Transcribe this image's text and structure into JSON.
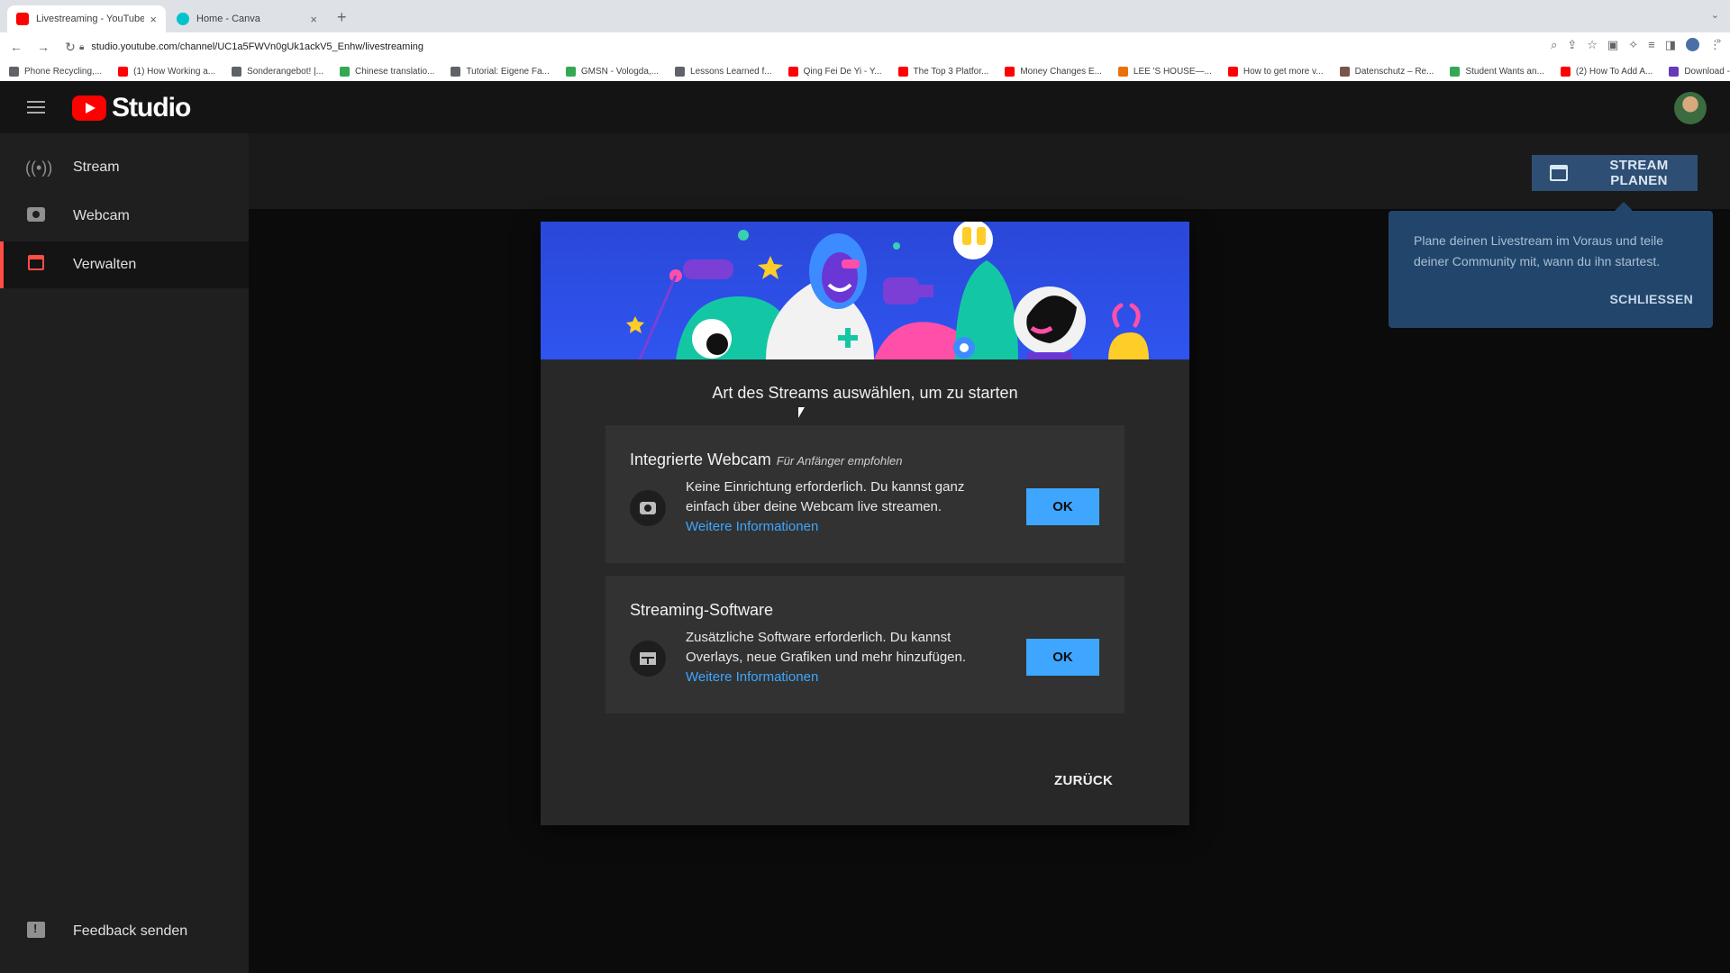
{
  "browser": {
    "tabs": [
      {
        "title": "Livestreaming - YouTube Studio",
        "favicon_color": "#ff0000"
      },
      {
        "title": "Home - Canva",
        "favicon_color": "#00c4cc"
      }
    ],
    "close_glyph": "×",
    "new_tab_glyph": "+",
    "url": "studio.youtube.com/channel/UC1a5FWVn0gUk1ackV5_Enhw/livestreaming",
    "bookmarks": [
      {
        "label": "Phone Recycling,...",
        "color": "#5f6368"
      },
      {
        "label": "(1) How Working a...",
        "color": "#ff0000"
      },
      {
        "label": "Sonderangebot! |...",
        "color": "#5f6368"
      },
      {
        "label": "Chinese translatio...",
        "color": "#34a853"
      },
      {
        "label": "Tutorial: Eigene Fa...",
        "color": "#5f6368"
      },
      {
        "label": "GMSN - Vologda,...",
        "color": "#34a853"
      },
      {
        "label": "Lessons Learned f...",
        "color": "#5f6368"
      },
      {
        "label": "Qing Fei De Yi - Y...",
        "color": "#ff0000"
      },
      {
        "label": "The Top 3 Platfor...",
        "color": "#ff0000"
      },
      {
        "label": "Money Changes E...",
        "color": "#ff0000"
      },
      {
        "label": "LEE 'S HOUSE—...",
        "color": "#e8710a"
      },
      {
        "label": "How to get more v...",
        "color": "#ff0000"
      },
      {
        "label": "Datenschutz – Re...",
        "color": "#795548"
      },
      {
        "label": "Student Wants an...",
        "color": "#34a853"
      },
      {
        "label": "(2) How To Add A...",
        "color": "#ff0000"
      },
      {
        "label": "Download - Cooki...",
        "color": "#673ab7"
      }
    ]
  },
  "app": {
    "logo_text": "Studio",
    "accent": "#ff4e45",
    "sidebar": {
      "items": [
        {
          "label": "Stream",
          "icon": "broadcast-icon"
        },
        {
          "label": "Webcam",
          "icon": "camera-icon"
        },
        {
          "label": "Verwalten",
          "icon": "calendar-icon",
          "active": true
        }
      ],
      "feedback_label": "Feedback senden"
    },
    "plan_button_label": "STREAM PLANEN",
    "tooltip": {
      "text": "Plane deinen Livestream im Voraus und teile deiner Community mit, wann du ihn startest.",
      "close_label": "SCHLIESSEN"
    },
    "dialog": {
      "title": "Art des Streams auswählen, um zu starten",
      "options": [
        {
          "title": "Integrierte Webcam",
          "subtitle": "Für Anfänger empfohlen",
          "description": "Keine Einrichtung erforderlich. Du kannst ganz einfach über deine Webcam live streamen.",
          "link": "Weitere Informationen",
          "button": "OK",
          "icon": "camera-icon"
        },
        {
          "title": "Streaming-Software",
          "subtitle": "",
          "description": "Zusätzliche Software erforderlich. Du kannst Overlays, neue Grafiken und mehr hinzufügen.",
          "link": "Weitere Informationen",
          "button": "OK",
          "icon": "software-window-icon"
        }
      ],
      "back_label": "ZURÜCK"
    }
  }
}
